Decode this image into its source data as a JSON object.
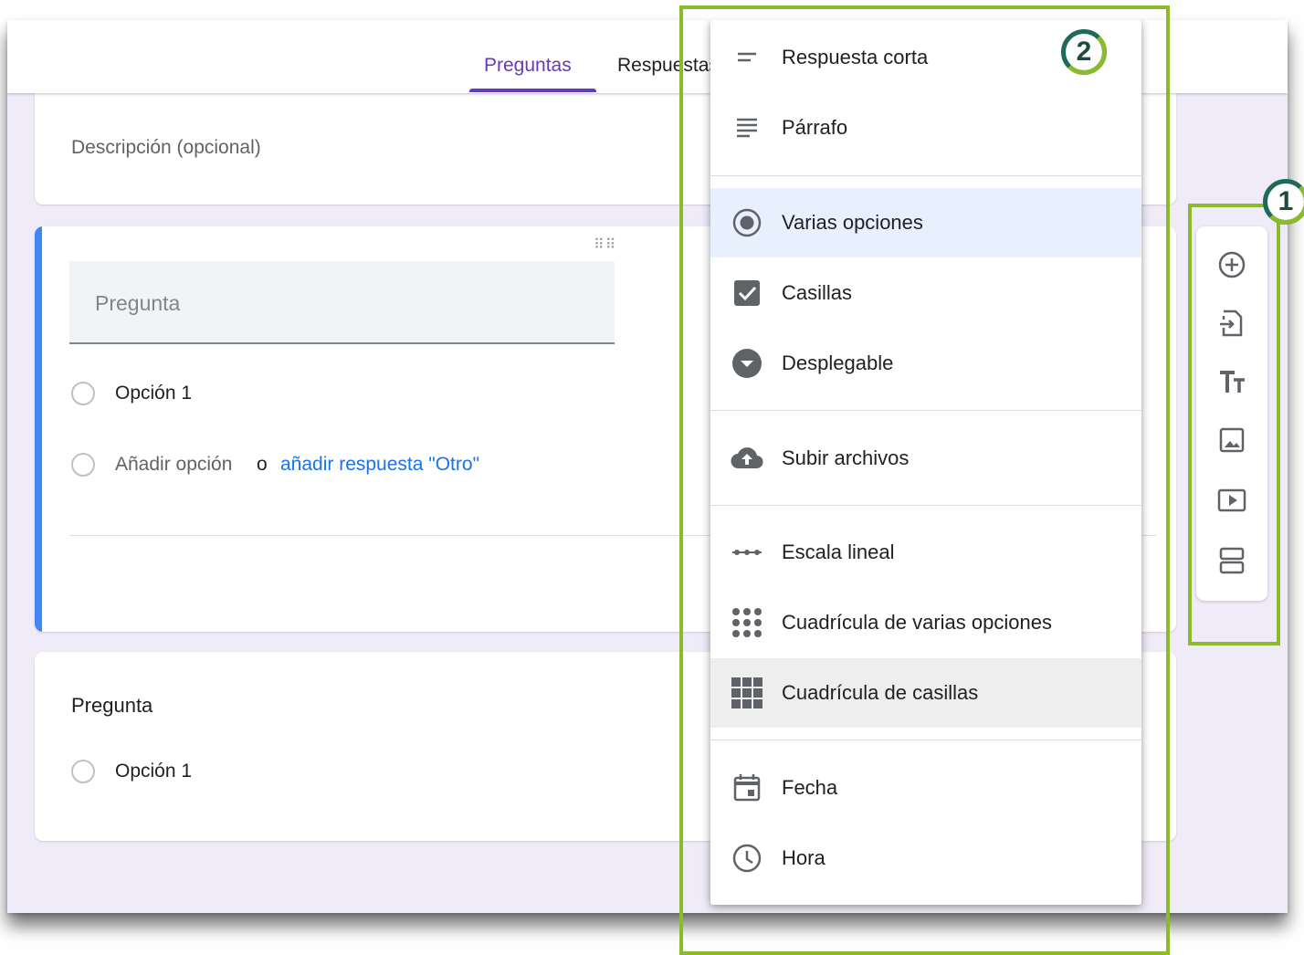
{
  "tabs": [
    {
      "label": "Preguntas",
      "active": true
    },
    {
      "label": "Respuestas",
      "active": false
    }
  ],
  "description_card": {
    "placeholder": "Descripción (opcional)"
  },
  "active_question": {
    "title_placeholder": "Pregunta",
    "option_1": "Opción 1",
    "add_option": "Añadir opción",
    "or_text": "o",
    "add_other": "añadir respuesta \"Otro\""
  },
  "second_question": {
    "title": "Pregunta",
    "option_1": "Opción 1"
  },
  "type_menu": {
    "items": [
      {
        "label": "Respuesta corta",
        "icon": "short-answer-icon"
      },
      {
        "label": "Párrafo",
        "icon": "paragraph-icon"
      },
      {
        "label": "Varias opciones",
        "icon": "radio-checked-icon",
        "selected": true
      },
      {
        "label": "Casillas",
        "icon": "checkbox-icon"
      },
      {
        "label": "Desplegable",
        "icon": "dropdown-circle-icon"
      },
      {
        "label": "Subir archivos",
        "icon": "cloud-upload-icon"
      },
      {
        "label": "Escala lineal",
        "icon": "linear-scale-icon"
      },
      {
        "label": "Cuadrícula de varias opciones",
        "icon": "dot-grid-icon"
      },
      {
        "label": "Cuadrícula de casillas",
        "icon": "checkbox-grid-icon",
        "hover": true
      },
      {
        "label": "Fecha",
        "icon": "calendar-icon"
      },
      {
        "label": "Hora",
        "icon": "clock-icon"
      }
    ]
  },
  "toolbar": {
    "icons": [
      "add-question-icon",
      "import-questions-icon",
      "add-title-icon",
      "add-image-icon",
      "add-video-icon",
      "add-section-icon"
    ]
  },
  "annotations": {
    "badge_1": "1",
    "badge_2": "2"
  },
  "colors": {
    "accent": "#673ab7",
    "link": "#1a73e8",
    "highlight": "#8bbb2a",
    "question_bar": "#4285f4",
    "background": "#f0ebf8"
  }
}
